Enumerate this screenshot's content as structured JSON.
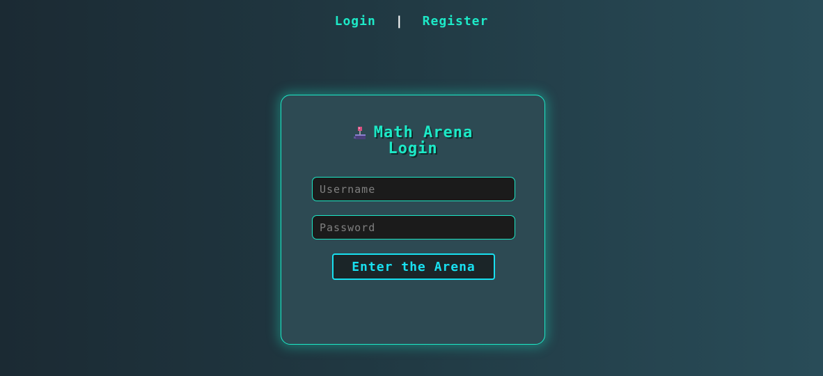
{
  "nav": {
    "login_label": "Login",
    "separator": "|",
    "register_label": "Register"
  },
  "login_card": {
    "title_line1": "Math Arena",
    "title_line2": "Login",
    "title_icon": "joystick-icon",
    "username": {
      "placeholder": "Username",
      "value": ""
    },
    "password": {
      "placeholder": "Password",
      "value": ""
    },
    "submit_label": "Enter the Arena"
  },
  "colors": {
    "accent": "#1de9c7",
    "button_accent": "#18e0f0",
    "card_bg": "#2d4a53",
    "input_bg": "#1b1b1b"
  }
}
